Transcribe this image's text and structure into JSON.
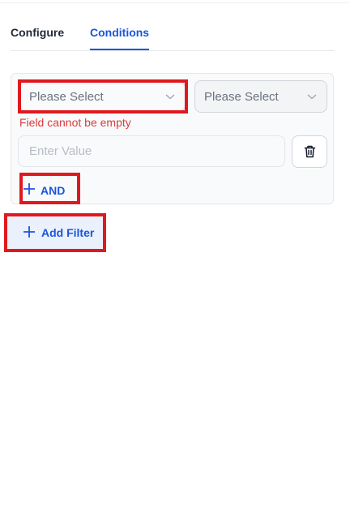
{
  "tabs": [
    {
      "label": "Configure",
      "active": false
    },
    {
      "label": "Conditions",
      "active": true
    }
  ],
  "condition": {
    "field_select": {
      "value": "Please Select"
    },
    "operator_select": {
      "value": "Please Select"
    },
    "error": "Field cannot be empty",
    "value_input": {
      "value": "",
      "placeholder": "Enter Value"
    },
    "delete_icon": "trash-icon",
    "and_button": {
      "label": "AND",
      "icon": "plus-icon"
    }
  },
  "add_filter_button": {
    "label": "Add Filter",
    "icon": "plus-icon"
  },
  "colors": {
    "accent": "#1a56db",
    "error": "#dc3b3b",
    "highlight": "#e0191f",
    "add_filter_bg": "#eaf1fd"
  }
}
